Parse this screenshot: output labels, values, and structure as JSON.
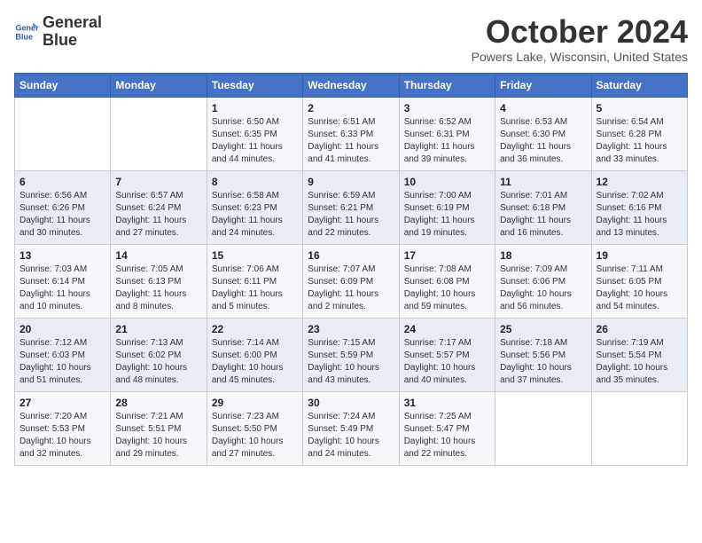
{
  "header": {
    "logo_line1": "General",
    "logo_line2": "Blue",
    "month": "October 2024",
    "location": "Powers Lake, Wisconsin, United States"
  },
  "weekdays": [
    "Sunday",
    "Monday",
    "Tuesday",
    "Wednesday",
    "Thursday",
    "Friday",
    "Saturday"
  ],
  "weeks": [
    [
      {
        "day": "",
        "info": ""
      },
      {
        "day": "",
        "info": ""
      },
      {
        "day": "1",
        "info": "Sunrise: 6:50 AM\nSunset: 6:35 PM\nDaylight: 11 hours and 44 minutes."
      },
      {
        "day": "2",
        "info": "Sunrise: 6:51 AM\nSunset: 6:33 PM\nDaylight: 11 hours and 41 minutes."
      },
      {
        "day": "3",
        "info": "Sunrise: 6:52 AM\nSunset: 6:31 PM\nDaylight: 11 hours and 39 minutes."
      },
      {
        "day": "4",
        "info": "Sunrise: 6:53 AM\nSunset: 6:30 PM\nDaylight: 11 hours and 36 minutes."
      },
      {
        "day": "5",
        "info": "Sunrise: 6:54 AM\nSunset: 6:28 PM\nDaylight: 11 hours and 33 minutes."
      }
    ],
    [
      {
        "day": "6",
        "info": "Sunrise: 6:56 AM\nSunset: 6:26 PM\nDaylight: 11 hours and 30 minutes."
      },
      {
        "day": "7",
        "info": "Sunrise: 6:57 AM\nSunset: 6:24 PM\nDaylight: 11 hours and 27 minutes."
      },
      {
        "day": "8",
        "info": "Sunrise: 6:58 AM\nSunset: 6:23 PM\nDaylight: 11 hours and 24 minutes."
      },
      {
        "day": "9",
        "info": "Sunrise: 6:59 AM\nSunset: 6:21 PM\nDaylight: 11 hours and 22 minutes."
      },
      {
        "day": "10",
        "info": "Sunrise: 7:00 AM\nSunset: 6:19 PM\nDaylight: 11 hours and 19 minutes."
      },
      {
        "day": "11",
        "info": "Sunrise: 7:01 AM\nSunset: 6:18 PM\nDaylight: 11 hours and 16 minutes."
      },
      {
        "day": "12",
        "info": "Sunrise: 7:02 AM\nSunset: 6:16 PM\nDaylight: 11 hours and 13 minutes."
      }
    ],
    [
      {
        "day": "13",
        "info": "Sunrise: 7:03 AM\nSunset: 6:14 PM\nDaylight: 11 hours and 10 minutes."
      },
      {
        "day": "14",
        "info": "Sunrise: 7:05 AM\nSunset: 6:13 PM\nDaylight: 11 hours and 8 minutes."
      },
      {
        "day": "15",
        "info": "Sunrise: 7:06 AM\nSunset: 6:11 PM\nDaylight: 11 hours and 5 minutes."
      },
      {
        "day": "16",
        "info": "Sunrise: 7:07 AM\nSunset: 6:09 PM\nDaylight: 11 hours and 2 minutes."
      },
      {
        "day": "17",
        "info": "Sunrise: 7:08 AM\nSunset: 6:08 PM\nDaylight: 10 hours and 59 minutes."
      },
      {
        "day": "18",
        "info": "Sunrise: 7:09 AM\nSunset: 6:06 PM\nDaylight: 10 hours and 56 minutes."
      },
      {
        "day": "19",
        "info": "Sunrise: 7:11 AM\nSunset: 6:05 PM\nDaylight: 10 hours and 54 minutes."
      }
    ],
    [
      {
        "day": "20",
        "info": "Sunrise: 7:12 AM\nSunset: 6:03 PM\nDaylight: 10 hours and 51 minutes."
      },
      {
        "day": "21",
        "info": "Sunrise: 7:13 AM\nSunset: 6:02 PM\nDaylight: 10 hours and 48 minutes."
      },
      {
        "day": "22",
        "info": "Sunrise: 7:14 AM\nSunset: 6:00 PM\nDaylight: 10 hours and 45 minutes."
      },
      {
        "day": "23",
        "info": "Sunrise: 7:15 AM\nSunset: 5:59 PM\nDaylight: 10 hours and 43 minutes."
      },
      {
        "day": "24",
        "info": "Sunrise: 7:17 AM\nSunset: 5:57 PM\nDaylight: 10 hours and 40 minutes."
      },
      {
        "day": "25",
        "info": "Sunrise: 7:18 AM\nSunset: 5:56 PM\nDaylight: 10 hours and 37 minutes."
      },
      {
        "day": "26",
        "info": "Sunrise: 7:19 AM\nSunset: 5:54 PM\nDaylight: 10 hours and 35 minutes."
      }
    ],
    [
      {
        "day": "27",
        "info": "Sunrise: 7:20 AM\nSunset: 5:53 PM\nDaylight: 10 hours and 32 minutes."
      },
      {
        "day": "28",
        "info": "Sunrise: 7:21 AM\nSunset: 5:51 PM\nDaylight: 10 hours and 29 minutes."
      },
      {
        "day": "29",
        "info": "Sunrise: 7:23 AM\nSunset: 5:50 PM\nDaylight: 10 hours and 27 minutes."
      },
      {
        "day": "30",
        "info": "Sunrise: 7:24 AM\nSunset: 5:49 PM\nDaylight: 10 hours and 24 minutes."
      },
      {
        "day": "31",
        "info": "Sunrise: 7:25 AM\nSunset: 5:47 PM\nDaylight: 10 hours and 22 minutes."
      },
      {
        "day": "",
        "info": ""
      },
      {
        "day": "",
        "info": ""
      }
    ]
  ]
}
